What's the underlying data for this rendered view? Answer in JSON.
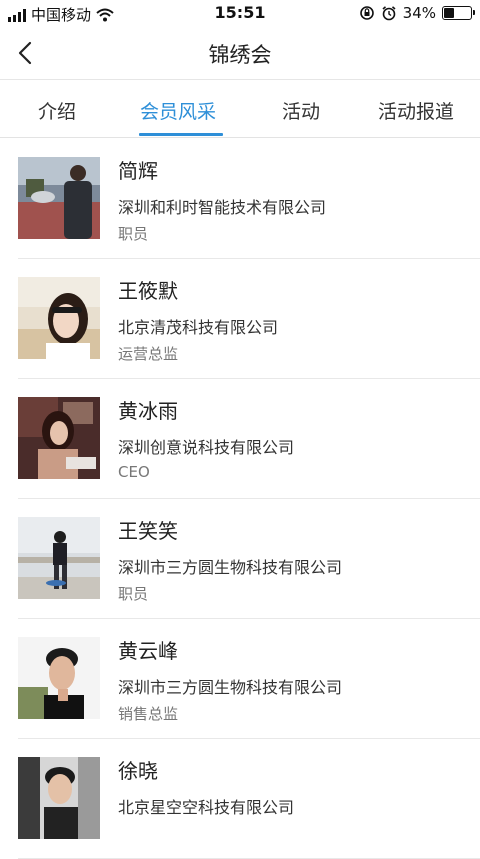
{
  "status_bar": {
    "carrier": "中国移动",
    "time": "15:51",
    "battery_percent": "34%",
    "battery_level": 0.34
  },
  "nav": {
    "title": "锦绣会"
  },
  "tabs": [
    {
      "label": "介绍",
      "active": false
    },
    {
      "label": "会员风采",
      "active": true
    },
    {
      "label": "活动",
      "active": false
    },
    {
      "label": "活动报道",
      "active": false
    }
  ],
  "members": [
    {
      "name": "简辉",
      "company": "深圳和利时智能技术有限公司",
      "title": "职员"
    },
    {
      "name": "王筱默",
      "company": "北京清茂科技有限公司",
      "title": "运营总监"
    },
    {
      "name": "黄冰雨",
      "company": "深圳创意说科技有限公司",
      "title": "CEO"
    },
    {
      "name": "王笑笑",
      "company": "深圳市三方圆生物科技有限公司",
      "title": "职员"
    },
    {
      "name": "黄云峰",
      "company": "深圳市三方圆生物科技有限公司",
      "title": "销售总监"
    },
    {
      "name": "徐晓",
      "company": "北京星空空科技有限公司",
      "title": ""
    }
  ]
}
